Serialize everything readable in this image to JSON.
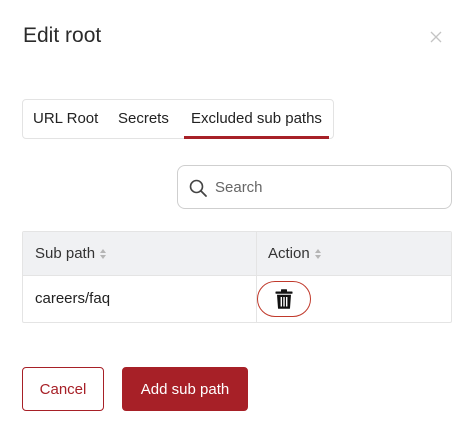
{
  "dialog": {
    "title": "Edit root",
    "close_icon": "close-icon"
  },
  "tabs": [
    {
      "label": "URL Root",
      "active": false
    },
    {
      "label": "Secrets",
      "active": false
    },
    {
      "label": "Excluded sub paths",
      "active": true
    }
  ],
  "search": {
    "placeholder": "Search",
    "value": ""
  },
  "table": {
    "columns": [
      {
        "label": "Sub path",
        "sortable": true
      },
      {
        "label": "Action",
        "sortable": true
      }
    ],
    "rows": [
      {
        "sub_path": "careers/faq",
        "action_icon": "trash-icon"
      }
    ]
  },
  "footer": {
    "cancel_label": "Cancel",
    "add_label": "Add sub path"
  },
  "colors": {
    "accent": "#a72027",
    "header_bg": "#f0f1f3",
    "border": "#e4e4e4"
  }
}
